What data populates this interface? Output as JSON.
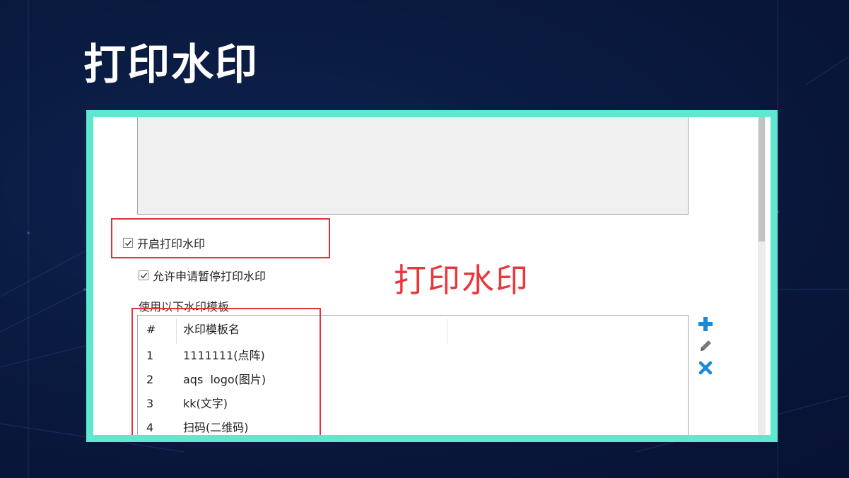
{
  "slide": {
    "title": "打印水印"
  },
  "settings": {
    "enable_watermark": {
      "label": "开启打印水印",
      "checked": true
    },
    "allow_pause": {
      "label": "允许申请暂停打印水印",
      "checked": true
    },
    "template_section_label": "使用以下水印模板"
  },
  "annotation": {
    "callout_text": "打印水印",
    "color": "#e0323a"
  },
  "templates_table": {
    "columns": [
      "#",
      "水印模板名",
      ""
    ],
    "rows": [
      {
        "num": "1",
        "name": "1111111(点阵)"
      },
      {
        "num": "2",
        "name": "aqs  logo(图片)"
      },
      {
        "num": "3",
        "name": "kk(文字)"
      },
      {
        "num": "4",
        "name": "扫码(二维码)"
      }
    ]
  },
  "toolbar": {
    "add_icon": "plus-icon",
    "edit_icon": "pencil-icon",
    "delete_icon": "close-icon",
    "add_color": "#1a8ad8",
    "edit_color": "#7a7a7a",
    "delete_color": "#1a8ad8"
  },
  "colors": {
    "frame": "#5fe8cf",
    "background": "#0a1a40"
  }
}
